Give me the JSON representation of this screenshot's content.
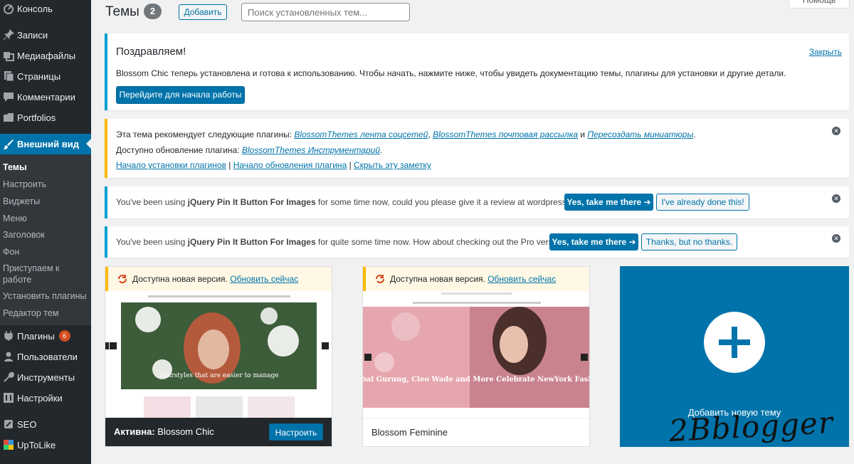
{
  "sidebar": {
    "items": [
      {
        "label": "Консоль",
        "icon": "dashboard-icon"
      },
      {
        "label": "Записи",
        "icon": "pin-icon"
      },
      {
        "label": "Медиафайлы",
        "icon": "media-icon"
      },
      {
        "label": "Страницы",
        "icon": "pages-icon"
      },
      {
        "label": "Комментарии",
        "icon": "comments-icon"
      },
      {
        "label": "Portfolios",
        "icon": "portfolio-icon"
      },
      {
        "label": "Внешний вид",
        "icon": "brush-icon"
      },
      {
        "label": "Плагины",
        "icon": "plugins-icon",
        "badge": "6"
      },
      {
        "label": "Пользователи",
        "icon": "users-icon"
      },
      {
        "label": "Инструменты",
        "icon": "tools-icon"
      },
      {
        "label": "Настройки",
        "icon": "settings-icon"
      },
      {
        "label": "SEO",
        "icon": "seo-icon"
      },
      {
        "label": "UpToLike",
        "icon": "uptolike-icon"
      }
    ],
    "submenu": [
      "Темы",
      "Настроить",
      "Виджеты",
      "Меню",
      "Заголовок",
      "Фон",
      "Приступаем к работе",
      "Установить плагины",
      "Редактор тем"
    ]
  },
  "header": {
    "title": "Темы",
    "count": "2",
    "add_label": "Добавить",
    "search_placeholder": "Поиск установленных тем...",
    "help_label": "Помощь"
  },
  "notice_welcome": {
    "title": "Поздравляем!",
    "close_label": "Закрыть",
    "text": "Blossom Chic теперь установлена и готова к использованию. Чтобы начать, нажмите ниже, чтобы увидеть документацию темы, плагины для установки и другие детали.",
    "button": "Перейдите для начала работы"
  },
  "notice_plugins": {
    "line1_prefix": "Эта тема рекомендует следующие плагины:",
    "plugin1": "BlossomThemes лента соцсетей",
    "plugin2": "BlossomThemes почтовая рассылка",
    "and": "и",
    "plugin3": "Пересоздать миниатюры",
    "line2_prefix": "Доступно обновление плагина:",
    "plugin4": "BlossomThemes Инструментарий",
    "link_install": "Начало установки плагинов",
    "link_update": "Начало обновления плагина",
    "link_hide": "Скрыть эту заметку"
  },
  "notice_review": {
    "text_prefix": "You've been using",
    "plugin": "jQuery Pin It Button For Images",
    "text_suffix": "for some time now, could you please give it a review at wordpress.org?",
    "yes_button": "Yes, take me there ➔",
    "done_button": "I've already done this!"
  },
  "notice_pro": {
    "text_prefix": "You've been using",
    "plugin": "jQuery Pin It Button For Images",
    "text_suffix": "for quite some time now. How about checking out the Pro version?",
    "yes_button": "Yes, take me there ➔",
    "no_button": "Thanks, but no thanks."
  },
  "themes": [
    {
      "update_text": "Доступна новая версия.",
      "update_link": "Обновить сейчас",
      "active_prefix": "Активна:",
      "name": "Blossom Chic",
      "customize": "Настроить",
      "hero_caption": "Hairstyles that are easier to manage"
    },
    {
      "update_text": "Доступна новая версия.",
      "update_link": "Обновить сейчас",
      "name": "Blossom Feminine",
      "hero_caption": "Prabal Gurung, Cleo Wade and More Celebrate NewYork Fashion"
    }
  ],
  "add_theme_label": "Добавить новую тему",
  "watermark": "2Bblogger",
  "colors": {
    "accent": "#0073aa",
    "sidebar": "#23282d",
    "warning": "#ffb900",
    "info": "#00a0d2"
  }
}
